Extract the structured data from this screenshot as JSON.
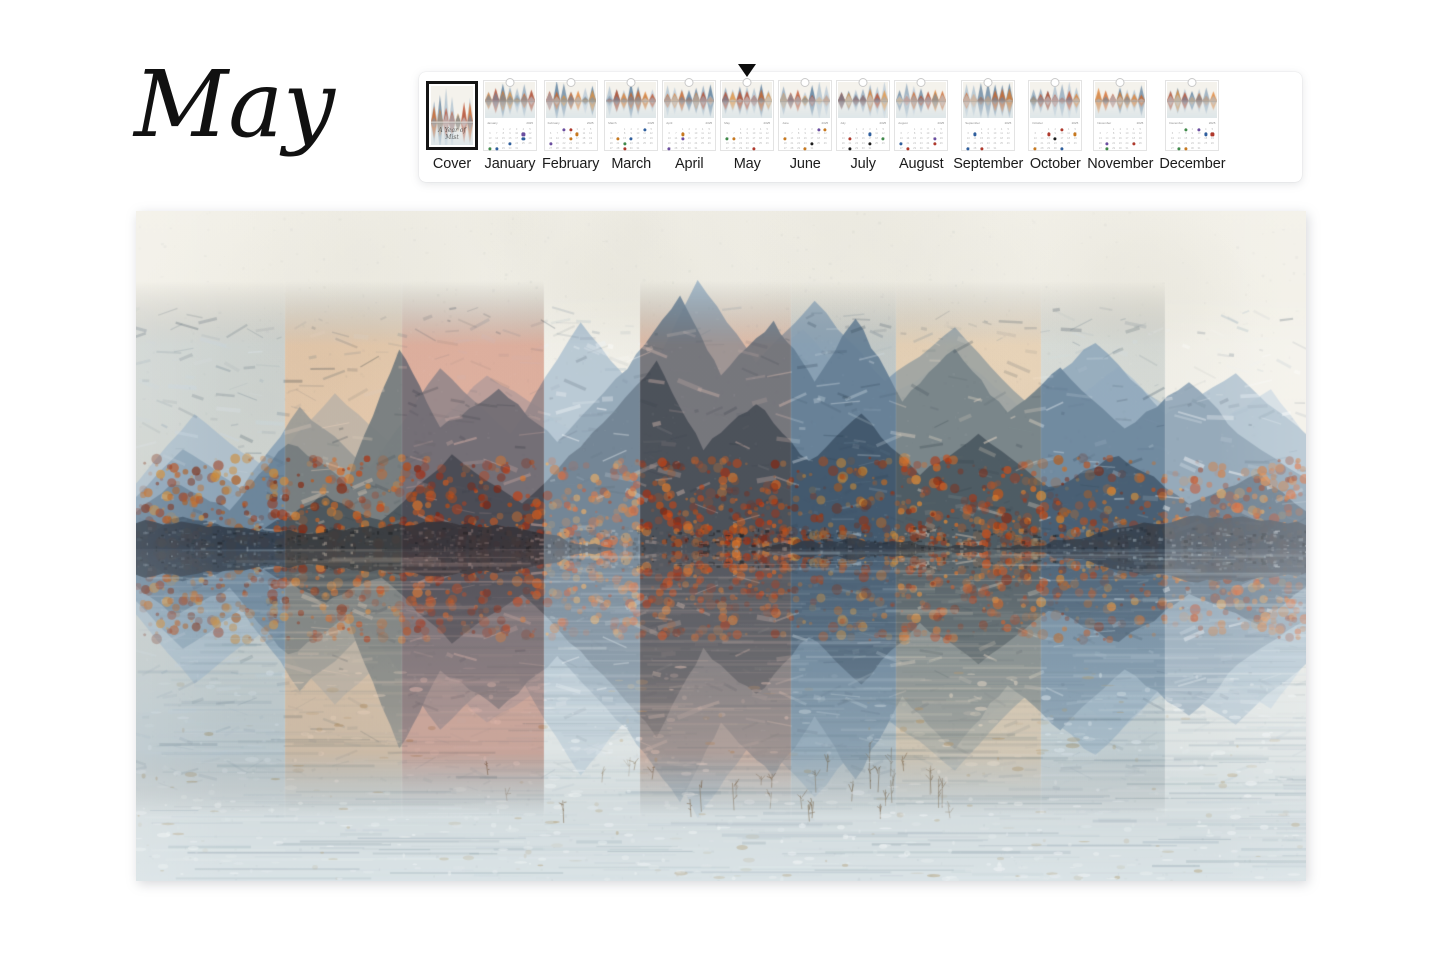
{
  "page": {
    "background_color": "#ffffff",
    "current_month_title": "May"
  },
  "filmstrip": {
    "selected_index": 5,
    "selected_label": "May",
    "selection_marker": "down-triangle",
    "items": [
      {
        "label": "Cover",
        "type": "cover",
        "year": "",
        "signature": "A Year of Mist"
      },
      {
        "label": "January",
        "type": "calendar",
        "year": "2025",
        "month_short": "January"
      },
      {
        "label": "February",
        "type": "calendar",
        "year": "2025",
        "month_short": "February"
      },
      {
        "label": "March",
        "type": "calendar",
        "year": "2025",
        "month_short": "March"
      },
      {
        "label": "April",
        "type": "calendar",
        "year": "2025",
        "month_short": "April"
      },
      {
        "label": "May",
        "type": "calendar",
        "year": "2025",
        "month_short": "May"
      },
      {
        "label": "June",
        "type": "calendar",
        "year": "2025",
        "month_short": "June"
      },
      {
        "label": "July",
        "type": "calendar",
        "year": "2025",
        "month_short": "July"
      },
      {
        "label": "August",
        "type": "calendar",
        "year": "2025",
        "month_short": "August"
      },
      {
        "label": "September",
        "type": "calendar",
        "year": "2025",
        "month_short": "September"
      },
      {
        "label": "October",
        "type": "calendar",
        "year": "2025",
        "month_short": "October"
      },
      {
        "label": "November",
        "type": "calendar",
        "year": "2025",
        "month_short": "November"
      },
      {
        "label": "December",
        "type": "calendar",
        "year": "2025",
        "month_short": "December"
      }
    ],
    "dot_palette": [
      "#c8791f",
      "#b0392c",
      "#2f5f9e",
      "#3f8a4a",
      "#6b4ea0",
      "#1d1d1d"
    ]
  },
  "hero": {
    "alt": "Watercolor mountain range mirrored in a still lake, segmented into vertical color panels",
    "sky_color": "#f2f0e8",
    "water_color": "#c8d2d6",
    "accent_warm": "#d9531e",
    "accent_cool": "#46607a",
    "panel_count": 9
  }
}
